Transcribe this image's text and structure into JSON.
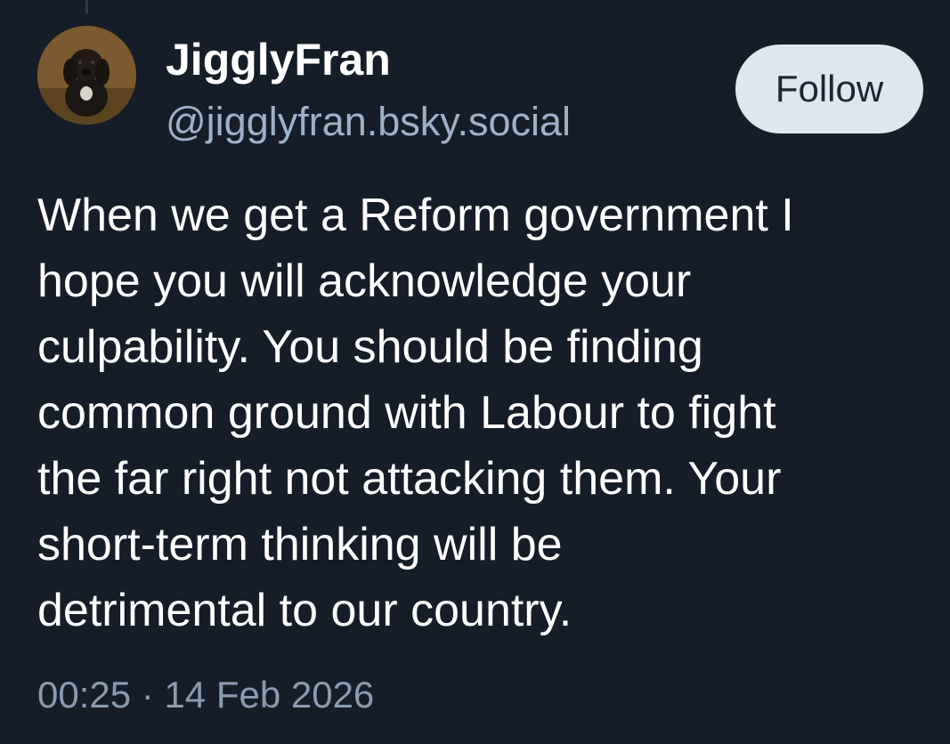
{
  "author": {
    "display_name": "JigglyFran",
    "handle": "@jigglyfran.bsky.social",
    "avatar_icon": "dog-avatar"
  },
  "follow_button": {
    "label": "Follow"
  },
  "post": {
    "lines": [
      "When we get a Reform government I",
      "hope you will acknowledge your",
      "culpability. You should be finding",
      "common ground with Labour to fight",
      "the far right not attacking them. Your",
      "short-term thinking will be",
      "detrimental to our country."
    ],
    "timestamp": "00:25 · 14 Feb 2026"
  },
  "colors": {
    "background": "#151d28",
    "handle": "#9fb1c9",
    "timestamp": "#8a9bb1",
    "follow_button_bg": "#dfe6ee"
  }
}
